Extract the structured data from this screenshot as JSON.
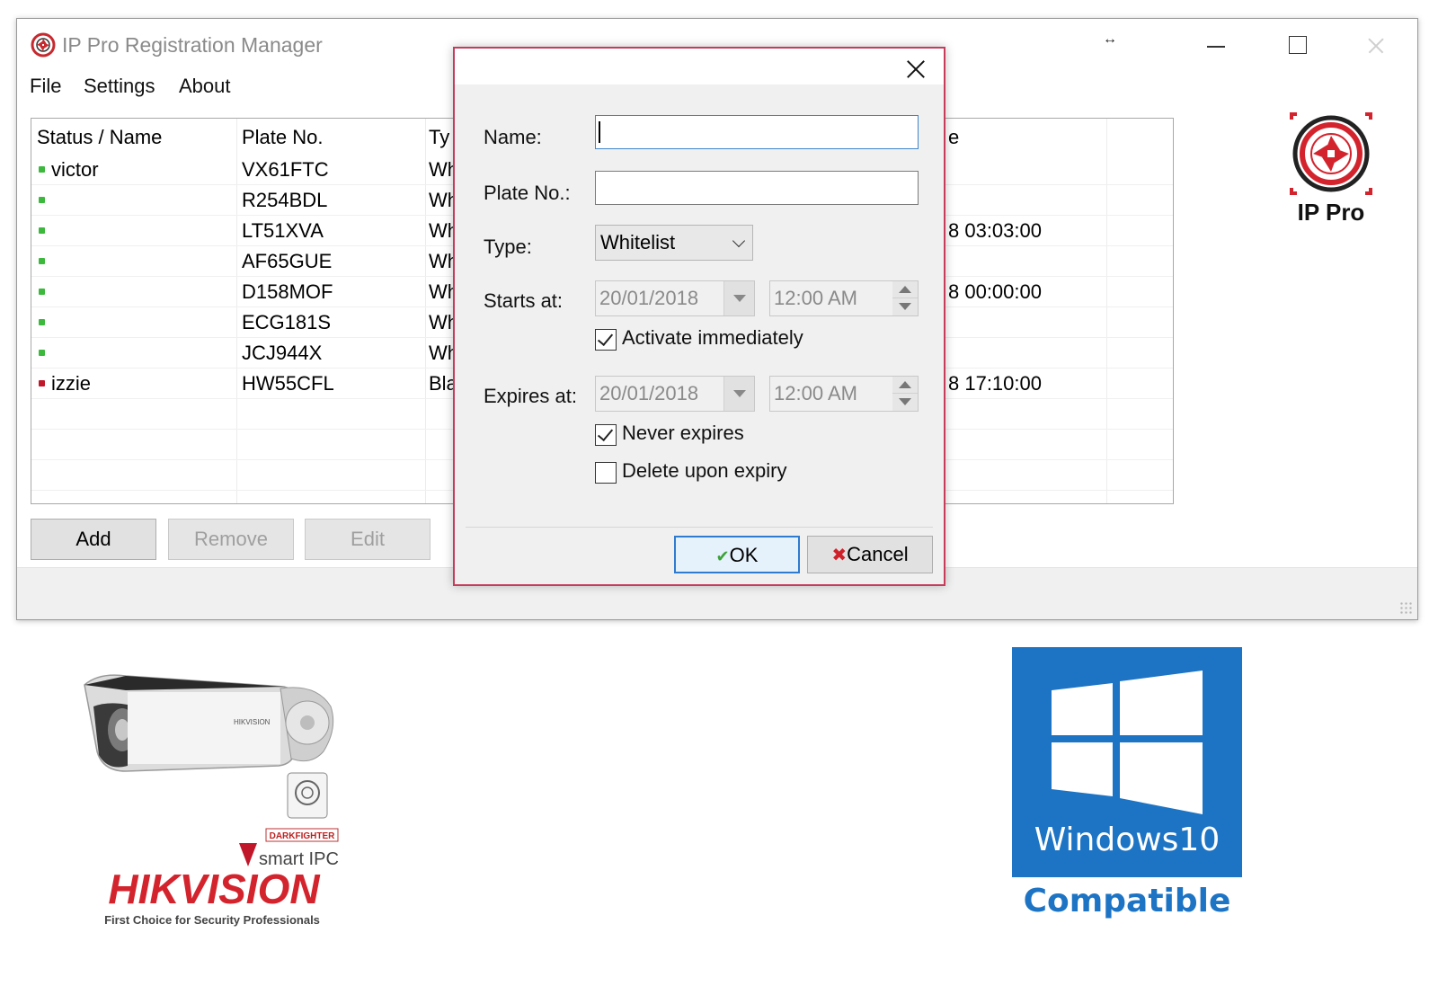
{
  "window": {
    "title": "IP Pro Registration Manager",
    "resize_glyph": "↔",
    "menu": [
      "File",
      "Settings",
      "About"
    ]
  },
  "grid": {
    "columns": [
      "Status / Name",
      "Plate No.",
      "Ty",
      "e"
    ],
    "rows": [
      {
        "status": "active",
        "name": "victor",
        "plate": "VX61FTC",
        "type": "Wh",
        "date": ""
      },
      {
        "status": "active",
        "name": "",
        "plate": "R254BDL",
        "type": "Wh",
        "date": ""
      },
      {
        "status": "active",
        "name": "",
        "plate": "LT51XVA",
        "type": "Wh",
        "date": "8 03:03:00"
      },
      {
        "status": "active",
        "name": "",
        "plate": "AF65GUE",
        "type": "Wh",
        "date": ""
      },
      {
        "status": "active",
        "name": "",
        "plate": "D158MOF",
        "type": "Wh",
        "date": "8 00:00:00"
      },
      {
        "status": "active",
        "name": "",
        "plate": "ECG181S",
        "type": "Wh",
        "date": ""
      },
      {
        "status": "active",
        "name": "",
        "plate": "JCJ944X",
        "type": "Wh",
        "date": ""
      },
      {
        "status": "blocked",
        "name": "izzie",
        "plate": "HW55CFL",
        "type": "Bla",
        "date": "8 17:10:00"
      }
    ]
  },
  "buttons": {
    "add": "Add",
    "remove": "Remove",
    "edit": "Edit"
  },
  "logo": {
    "text": "IP Pro"
  },
  "dialog": {
    "name_label": "Name:",
    "name_value": "",
    "plate_label": "Plate No.:",
    "plate_value": "",
    "type_label": "Type:",
    "type_value": "Whitelist",
    "starts_label": "Starts at:",
    "starts_date": "20/01/2018",
    "starts_time": "12:00  AM",
    "activate_label": "Activate immediately",
    "activate_checked": true,
    "expires_label": "Expires at:",
    "expires_date": "20/01/2018",
    "expires_time": "12:00  AM",
    "never_expires_label": "Never expires",
    "never_expires_checked": true,
    "delete_label": "Delete upon expiry",
    "delete_checked": false,
    "ok_label": "OK",
    "cancel_label": "Cancel"
  },
  "promo": {
    "camera_brand_small": "HIKVISION",
    "darkfighter": "DARKFIGHTER",
    "smart_ipc": "smart IPC",
    "hikvision": "HIKVISION",
    "tagline": "First Choice for Security Professionals",
    "windows_text": "Windows10",
    "compatible_text": "Compatible"
  },
  "colors": {
    "active": "#3cb83c",
    "blocked": "#c0182a",
    "dialog_border": "#c63d5c",
    "brand_red": "#d3242e",
    "windows_blue": "#1d74c4"
  }
}
